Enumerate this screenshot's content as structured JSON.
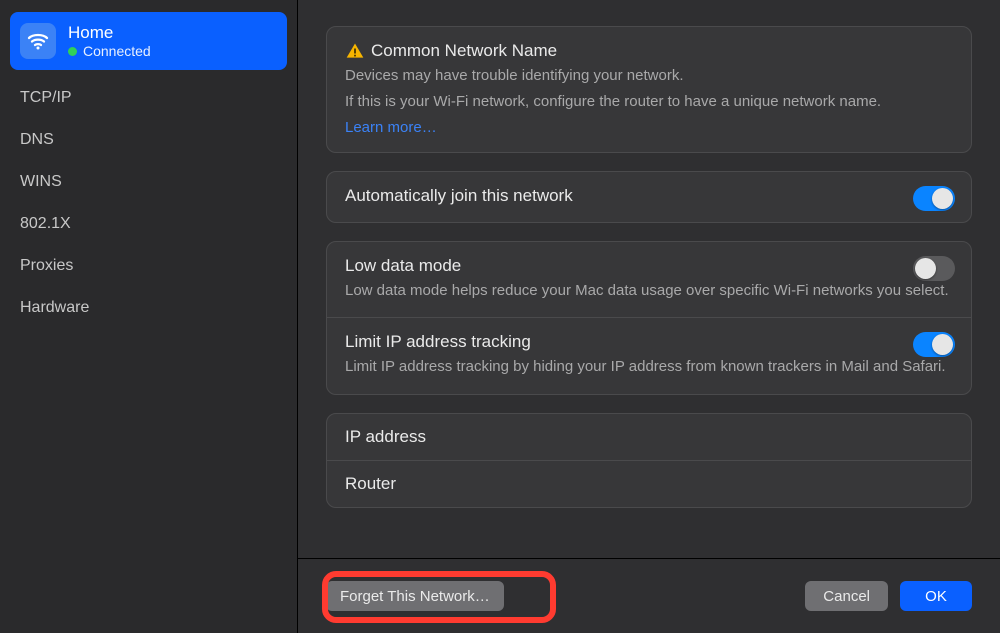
{
  "sidebar": {
    "header": {
      "name": "Home",
      "status": "Connected"
    },
    "items": [
      "TCP/IP",
      "DNS",
      "WINS",
      "802.1X",
      "Proxies",
      "Hardware"
    ]
  },
  "warning": {
    "title": "Common Network Name",
    "line1": "Devices may have trouble identifying your network.",
    "line2": "If this is your Wi-Fi network, configure the router to have a unique network name.",
    "link": "Learn more…"
  },
  "settings": {
    "autojoin": {
      "label": "Automatically join this network",
      "on": true
    },
    "lowdata": {
      "label": "Low data mode",
      "desc": "Low data mode helps reduce your Mac data usage over specific Wi-Fi networks you select.",
      "on": false
    },
    "limitip": {
      "label": "Limit IP address tracking",
      "desc": "Limit IP address tracking by hiding your IP address from known trackers in Mail and Safari.",
      "on": true
    }
  },
  "info": {
    "ip_label": "IP address",
    "router_label": "Router"
  },
  "footer": {
    "forget": "Forget This Network…",
    "cancel": "Cancel",
    "ok": "OK"
  }
}
